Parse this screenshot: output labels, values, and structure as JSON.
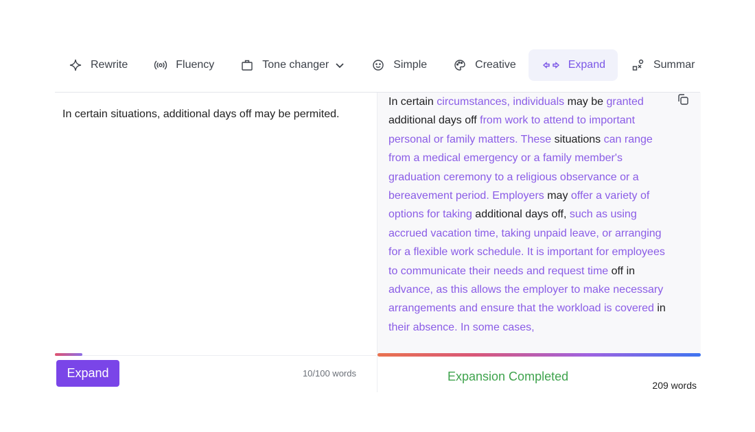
{
  "toolbar": {
    "modes": [
      {
        "label": "Rewrite",
        "icon": "sparkle-icon",
        "active": false
      },
      {
        "label": "Fluency",
        "icon": "broadcast-icon",
        "active": false
      },
      {
        "label": "Tone changer",
        "icon": "briefcase-icon",
        "active": false,
        "has_dropdown": true
      },
      {
        "label": "Simple",
        "icon": "smiley-icon",
        "active": false
      },
      {
        "label": "Creative",
        "icon": "palette-icon",
        "active": false
      },
      {
        "label": "Expand",
        "icon": "expand-arrows-icon",
        "active": true
      },
      {
        "label": "Summar",
        "icon": "shapes-icon",
        "active": false
      }
    ]
  },
  "input": {
    "text": "In certain situations, additional days off may be permited.",
    "word_count": "10/100 words",
    "action_label": "Expand",
    "progress_fraction": 0.085
  },
  "output": {
    "segments": [
      {
        "text": "In certain ",
        "highlight": false
      },
      {
        "text": "circumstances, individuals",
        "highlight": true
      },
      {
        "text": " may be ",
        "highlight": false
      },
      {
        "text": "granted",
        "highlight": true
      },
      {
        "text": " additional days off ",
        "highlight": false
      },
      {
        "text": "from work to attend to important personal or family matters. These",
        "highlight": true
      },
      {
        "text": " situations ",
        "highlight": false
      },
      {
        "text": "can range from a medical emergency or a family member's graduation ceremony to a religious observance or a bereavement period. Employers",
        "highlight": true
      },
      {
        "text": " may ",
        "highlight": false
      },
      {
        "text": "offer a variety of options for taking",
        "highlight": true
      },
      {
        "text": " additional days off, ",
        "highlight": false
      },
      {
        "text": "such as using accrued vacation time, taking unpaid leave, or arranging for a flexible work schedule. It is important for employees to communicate their needs and request time",
        "highlight": true
      },
      {
        "text": " off in ",
        "highlight": false
      },
      {
        "text": "advance, as this allows the employer to make necessary arrangements and ensure that the workload is covered",
        "highlight": true
      },
      {
        "text": " in ",
        "highlight": false
      },
      {
        "text": "their absence. In some cases,",
        "highlight": true
      }
    ],
    "status": "Expansion Completed",
    "word_count": "209 words",
    "progress_fraction": 1.0
  },
  "colors": {
    "accent": "#7a45e8",
    "highlight_text": "#8a5ce6",
    "status_green": "#3fa34d",
    "active_tab_bg": "#f1f2fb"
  }
}
